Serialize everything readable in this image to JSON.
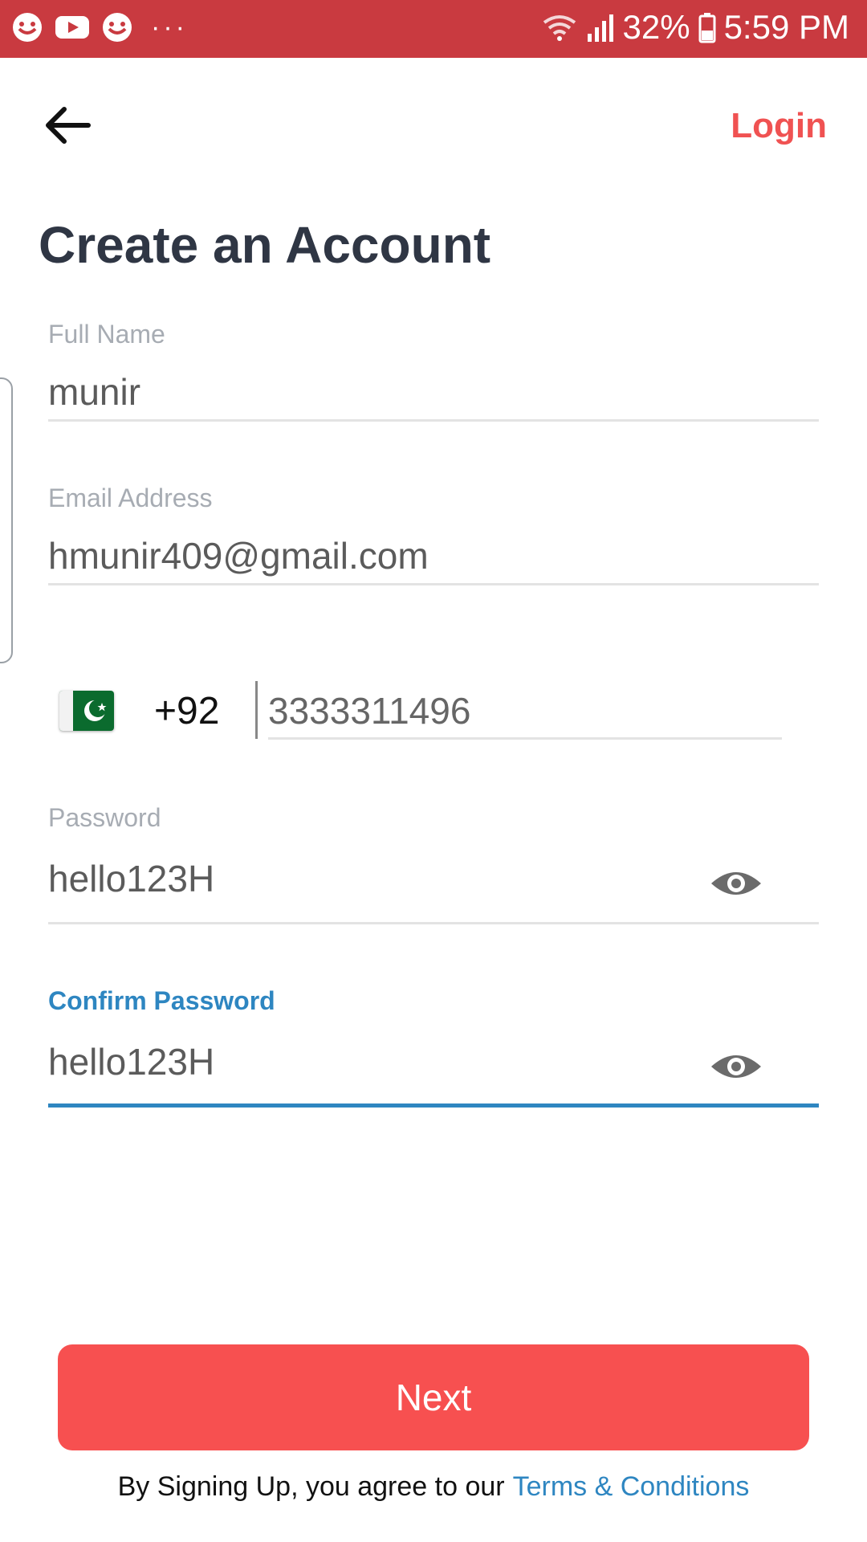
{
  "status_bar": {
    "icons": [
      "smiley-notification-icon",
      "youtube-icon",
      "smiley-notification-icon"
    ],
    "more": "···",
    "battery": "32%",
    "time": "5:59 PM",
    "background": "#c93a40"
  },
  "header": {
    "back_icon": "arrow-left-icon",
    "login_label": "Login"
  },
  "title": "Create an Account",
  "fields": {
    "full_name": {
      "label": "Full Name",
      "value": "munir"
    },
    "email": {
      "label": "Email Address",
      "value": "hmunir409@gmail.com"
    },
    "phone": {
      "country_flag": "pakistan-flag",
      "country_code": "+92",
      "number": "3333311496"
    },
    "password": {
      "label": "Password",
      "value": "hello123H",
      "toggle_icon": "eye-icon"
    },
    "confirm_password": {
      "label": "Confirm Password",
      "value": "hello123H",
      "toggle_icon": "eye-icon",
      "focused": true
    }
  },
  "next_label": "Next",
  "terms": {
    "prefix": "By Signing Up, you agree to our",
    "link": "Terms & Conditions"
  },
  "colors": {
    "accent": "#f75050",
    "link": "#2e86c1",
    "title": "#2f3644"
  }
}
